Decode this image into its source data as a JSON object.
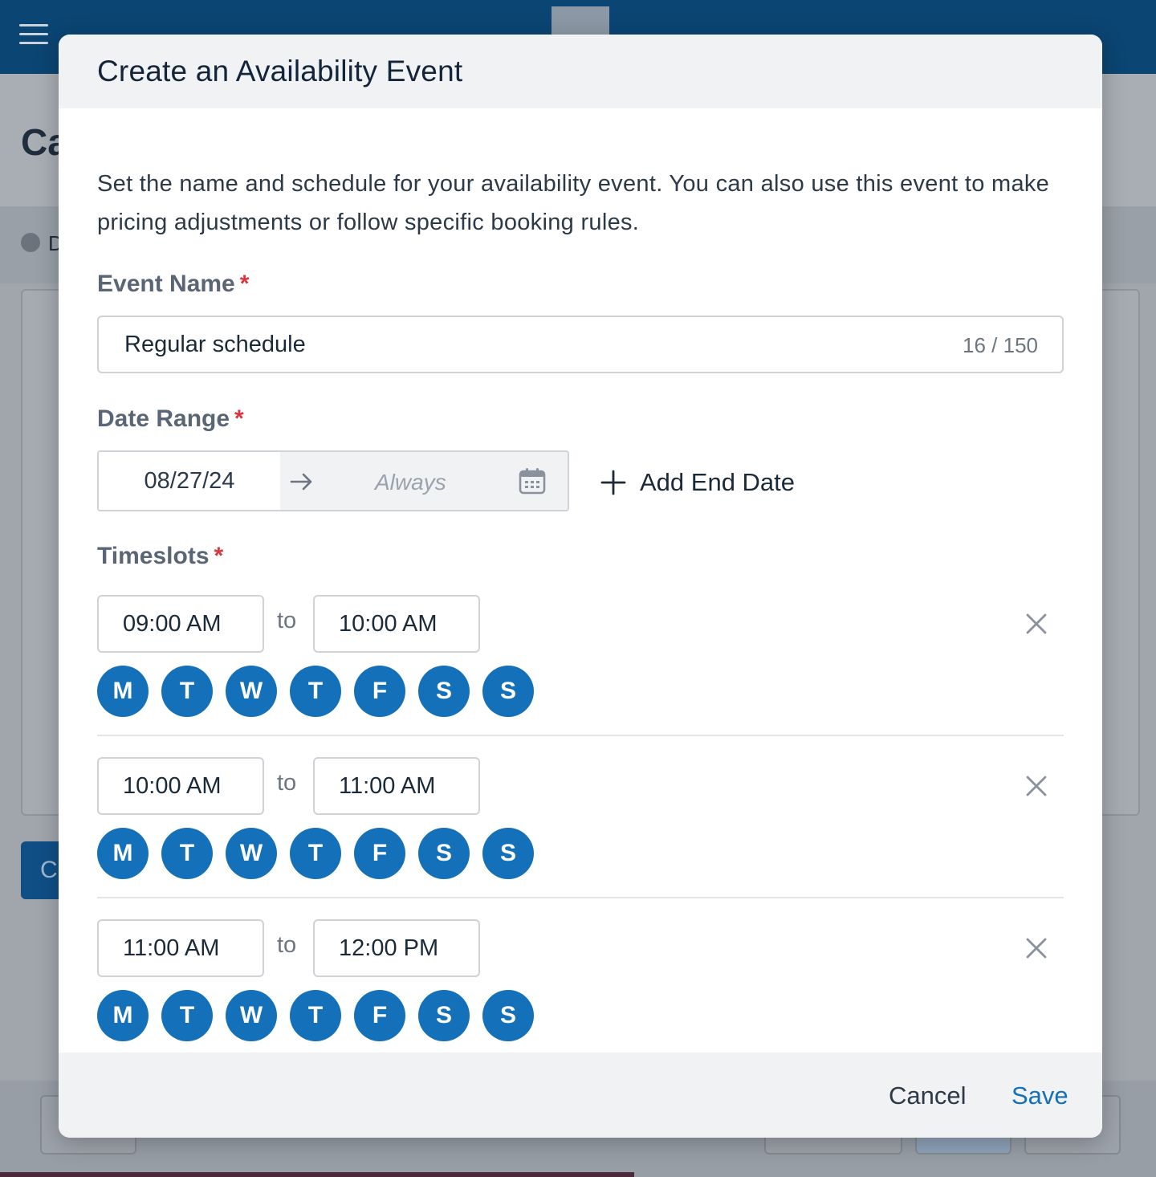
{
  "background": {
    "page_title_partial": "Ca",
    "status_partial": "D",
    "primary_button_partial": "C"
  },
  "modal": {
    "title": "Create an Availability Event",
    "description": "Set the name and schedule for your availability event. You can also use this event to make pricing adjustments or follow specific booking rules.",
    "required_mark": "*",
    "event_name": {
      "label": "Event Name",
      "value": "Regular schedule",
      "counter": "16 / 150"
    },
    "date_range": {
      "label": "Date Range",
      "start": "08/27/24",
      "end_placeholder": "Always",
      "add_end_label": "Add End Date"
    },
    "timeslots": {
      "label": "Timeslots",
      "to_label": "to",
      "items": [
        {
          "start": "09:00 AM",
          "end": "10:00 AM",
          "days": [
            "M",
            "T",
            "W",
            "T",
            "F",
            "S",
            "S"
          ]
        },
        {
          "start": "10:00 AM",
          "end": "11:00 AM",
          "days": [
            "M",
            "T",
            "W",
            "T",
            "F",
            "S",
            "S"
          ]
        },
        {
          "start": "11:00 AM",
          "end": "12:00 PM",
          "days": [
            "M",
            "T",
            "W",
            "T",
            "F",
            "S",
            "S"
          ]
        }
      ]
    },
    "footer": {
      "cancel_label": "Cancel",
      "save_label": "Save"
    }
  },
  "colors": {
    "accent": "#1470b8",
    "required": "#d9363e",
    "topbar": "#0b4573"
  },
  "icons": {
    "menu": "hamburger-menu-icon",
    "arrow": "arrow-right-icon",
    "calendar": "calendar-icon",
    "add": "plus-icon",
    "remove": "close-icon"
  }
}
